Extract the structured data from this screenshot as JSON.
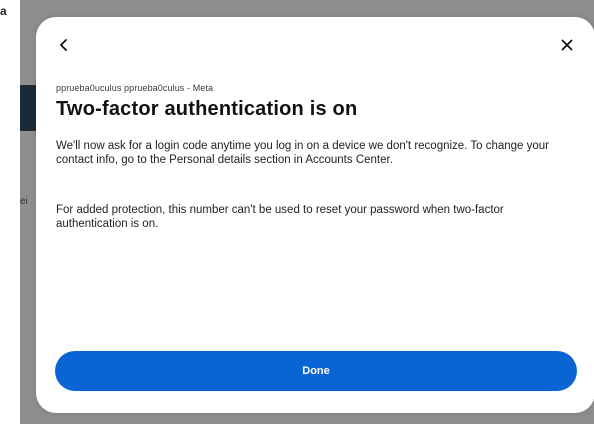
{
  "background": {
    "edge_text_top": "a",
    "edge_text_mid": "ei"
  },
  "modal": {
    "account_line": "pprueba0uculus pprueba0culus - Meta",
    "title": "Two-factor authentication is on",
    "paragraphs": [
      "We'll now ask for a login code anytime you log in on a device we don't recognize. To change your contact info, go to the Personal details section in Accounts Center.",
      "For added protection, this number can't be used to reset your password when two-factor authentication is on."
    ],
    "done_label": "Done",
    "back_icon": "chevron-left-icon",
    "close_icon": "close-icon"
  },
  "colors": {
    "accent": "#0b64d4",
    "backdrop": "#8e8e8e"
  }
}
